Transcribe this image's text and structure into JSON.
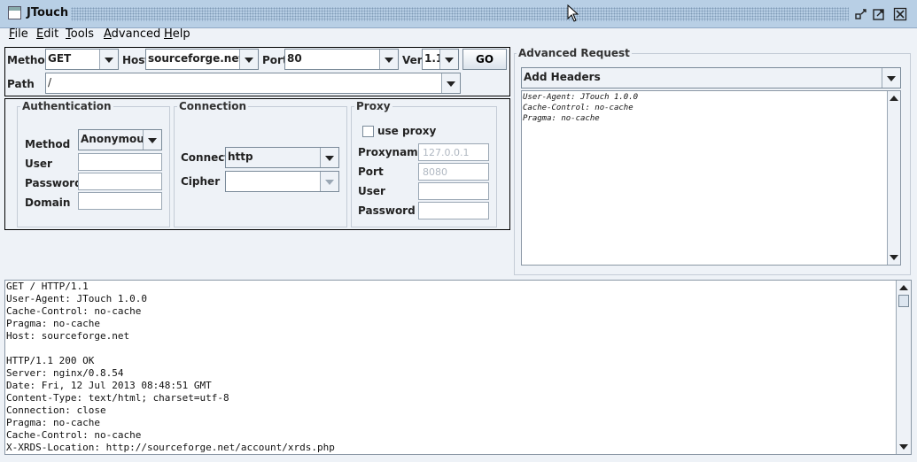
{
  "window": {
    "title": "JTouch"
  },
  "menu": [
    {
      "mnemonic": "F",
      "rest": "ile"
    },
    {
      "mnemonic": "E",
      "rest": "dit"
    },
    {
      "mnemonic": "T",
      "rest": "ools"
    },
    {
      "mnemonic": "A",
      "rest": "dvanced"
    },
    {
      "mnemonic": "H",
      "rest": "elp"
    }
  ],
  "request": {
    "method_label": "Method",
    "method_value": "GET",
    "host_label": "Host",
    "host_value": "sourceforge.net",
    "port_label": "Port",
    "port_value": "80",
    "ver_label": "Ver",
    "ver_value": "1.1",
    "go_label": "GO",
    "path_label": "Path",
    "path_value": "/"
  },
  "auth": {
    "title": "Authentication",
    "method_label": "Method",
    "method_value": "Anonymous",
    "user_label": "User",
    "password_label": "Password",
    "domain_label": "Domain"
  },
  "connection": {
    "title": "Connection",
    "connect_label": "Connect",
    "connect_value": "http",
    "cipher_label": "Cipher"
  },
  "proxy": {
    "title": "Proxy",
    "use_proxy_label": "use proxy",
    "use_proxy_checked": false,
    "proxyname_label": "Proxyname",
    "proxyname_placeholder": "127.0.0.1",
    "port_label": "Port",
    "port_placeholder": "8080",
    "user_label": "User",
    "password_label": "Password"
  },
  "advanced": {
    "title": "Advanced Request",
    "headers_combo": "Add Headers",
    "headers_lines": [
      "User-Agent: JTouch 1.0.0",
      "Cache-Control: no-cache",
      "Pragma: no-cache"
    ]
  },
  "response": {
    "lines": [
      "GET / HTTP/1.1",
      "User-Agent: JTouch 1.0.0",
      "Cache-Control: no-cache",
      "Pragma: no-cache",
      "Host: sourceforge.net",
      "",
      "HTTP/1.1 200 OK",
      "Server: nginx/0.8.54",
      "Date: Fri, 12 Jul 2013 08:48:51 GMT",
      "Content-Type: text/html; charset=utf-8",
      "Connection: close",
      "Pragma: no-cache",
      "Cache-Control: no-cache",
      "X-XRDS-Location: http://sourceforge.net/account/xrds.php"
    ]
  },
  "icons": {
    "minimize": "minimize-icon",
    "maximize": "maximize-icon",
    "close": "close-icon",
    "cursor": "mouse-cursor-icon"
  },
  "colors": {
    "titlebar": "#b8cfe5",
    "background": "#eef2f7"
  }
}
